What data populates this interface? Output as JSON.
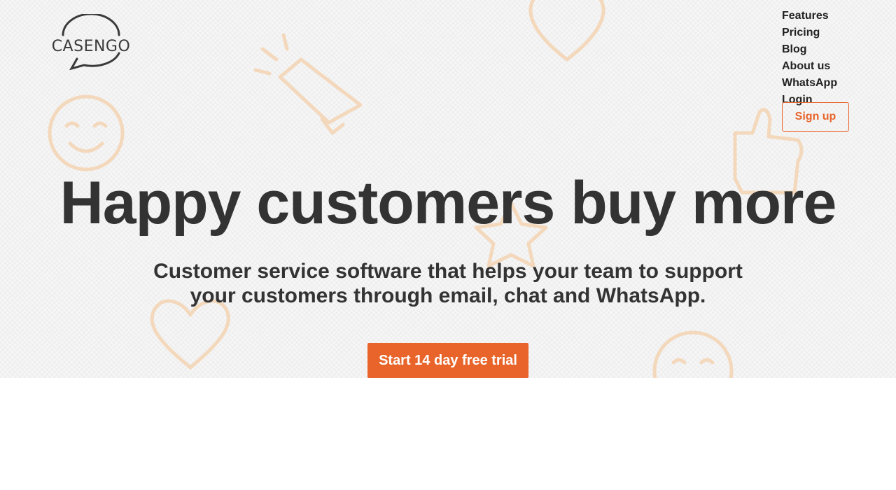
{
  "brand": {
    "logo_text": "CASENGO",
    "accent_color": "#e8642a",
    "text_color": "#333333"
  },
  "nav": {
    "items": [
      "Features",
      "Pricing",
      "Blog",
      "About us",
      "WhatsApp",
      "Login"
    ],
    "signup_label": "Sign up"
  },
  "hero": {
    "headline": "Happy customers buy more",
    "subheadline": "Customer service software that helps your team to support your customers through email, chat and WhatsApp.",
    "cta_label": "Start 14 day free trial",
    "background_icons": [
      "heart-icon",
      "megaphone-icon",
      "smiley-icon",
      "thumbs-up-icon",
      "star-icon",
      "heart-icon",
      "smiley-icon"
    ]
  }
}
